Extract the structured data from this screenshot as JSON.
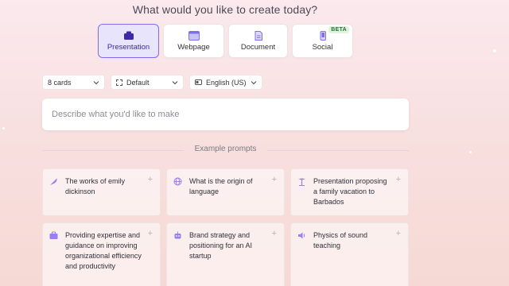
{
  "heading": "What would you like to create today?",
  "types": [
    {
      "label": "Presentation",
      "icon": "presentation-icon",
      "selected": true
    },
    {
      "label": "Webpage",
      "icon": "webpage-icon",
      "selected": false
    },
    {
      "label": "Document",
      "icon": "document-icon",
      "selected": false
    },
    {
      "label": "Social",
      "icon": "social-icon",
      "selected": false,
      "badge": "BETA"
    }
  ],
  "options": {
    "cards": "8 cards",
    "theme": "Default",
    "language": "English (US)"
  },
  "prompt": {
    "placeholder": "Describe what you'd like to make",
    "value": ""
  },
  "examples_label": "Example prompts",
  "examples": [
    {
      "text": "The works of emily dickinson",
      "icon": "feather-icon"
    },
    {
      "text": "What is the origin of language",
      "icon": "globe-icon"
    },
    {
      "text": "Presentation proposing a family vacation to Barbados",
      "icon": "palm-tree-icon"
    },
    {
      "text": "Providing expertise and guidance on improving organizational efficiency and productivity",
      "icon": "briefcase-icon"
    },
    {
      "text": "Brand strategy and positioning for an AI startup",
      "icon": "robot-icon"
    },
    {
      "text": "Physics of sound teaching",
      "icon": "speaker-icon"
    }
  ],
  "colors": {
    "accent": "#7d6ef0",
    "selected_bg": "#e8e4fb",
    "beta_bg": "#dff3dd"
  }
}
